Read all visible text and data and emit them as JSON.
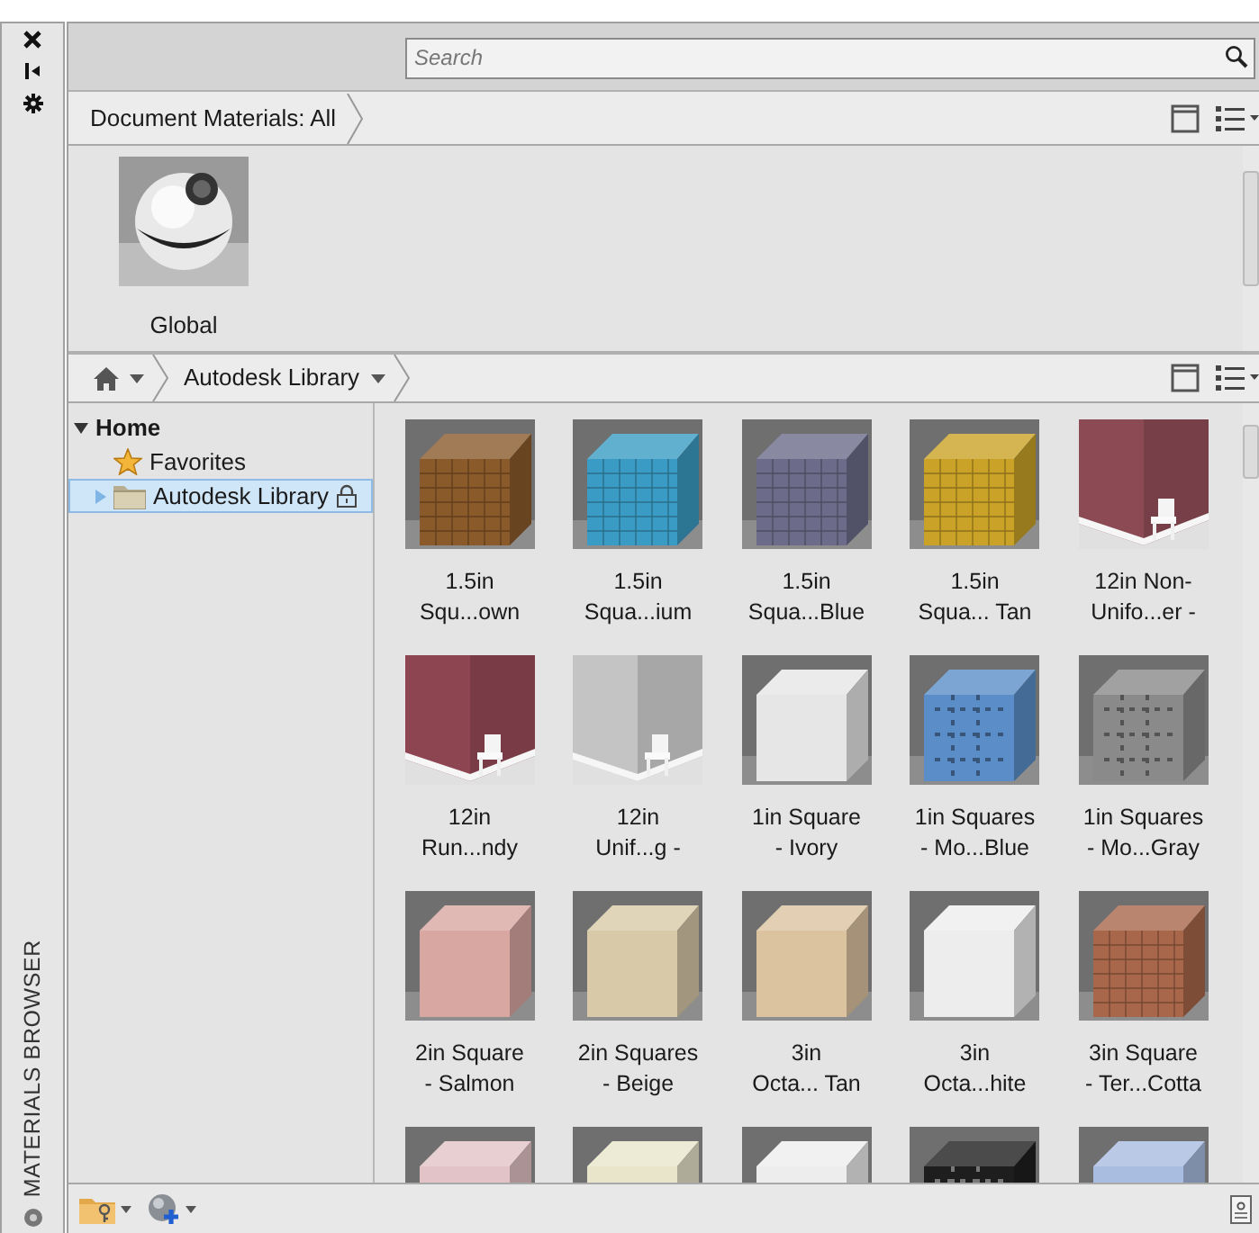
{
  "palette": {
    "title": "MATERIALS BROWSER"
  },
  "search": {
    "placeholder": "Search"
  },
  "document_materials": {
    "breadcrumb": "Document Materials: All",
    "materials": [
      {
        "label": "Global"
      }
    ]
  },
  "library": {
    "breadcrumb": "Autodesk Library",
    "tree": [
      {
        "label": "Home",
        "expanded": true,
        "children": [
          {
            "label": "Favorites",
            "kind": "favorites",
            "selected": false,
            "locked": false
          },
          {
            "label": "Autodesk Library",
            "kind": "folder",
            "selected": true,
            "locked": true,
            "expanded": false
          }
        ]
      }
    ],
    "materials": [
      {
        "lines": [
          "1.5in",
          "Squ...own"
        ]
      },
      {
        "lines": [
          "1.5in",
          "Squa...ium"
        ]
      },
      {
        "lines": [
          "1.5in",
          "Squa...Blue"
        ]
      },
      {
        "lines": [
          "1.5in",
          "Squa... Tan"
        ]
      },
      {
        "lines": [
          "12in Non-",
          "Unifo...er -"
        ]
      },
      {
        "lines": [
          "12in",
          "Run...ndy"
        ]
      },
      {
        "lines": [
          "12in",
          "Unif...g -"
        ]
      },
      {
        "lines": [
          "1in Square",
          "- Ivory"
        ]
      },
      {
        "lines": [
          "1in Squares",
          "- Mo...Blue"
        ]
      },
      {
        "lines": [
          "1in Squares",
          "- Mo...Gray"
        ]
      },
      {
        "lines": [
          "2in Square",
          "- Salmon"
        ]
      },
      {
        "lines": [
          "2in Squares",
          "- Beige"
        ]
      },
      {
        "lines": [
          "3in",
          "Octa... Tan"
        ]
      },
      {
        "lines": [
          "3in",
          "Octa...hite"
        ]
      },
      {
        "lines": [
          "3in Square",
          "- Ter...Cotta"
        ]
      },
      {
        "kind": "picture"
      },
      {
        "kind": "picture"
      },
      {
        "kind": "picture"
      },
      {
        "kind": "picture"
      },
      {
        "kind": "picture"
      }
    ]
  }
}
